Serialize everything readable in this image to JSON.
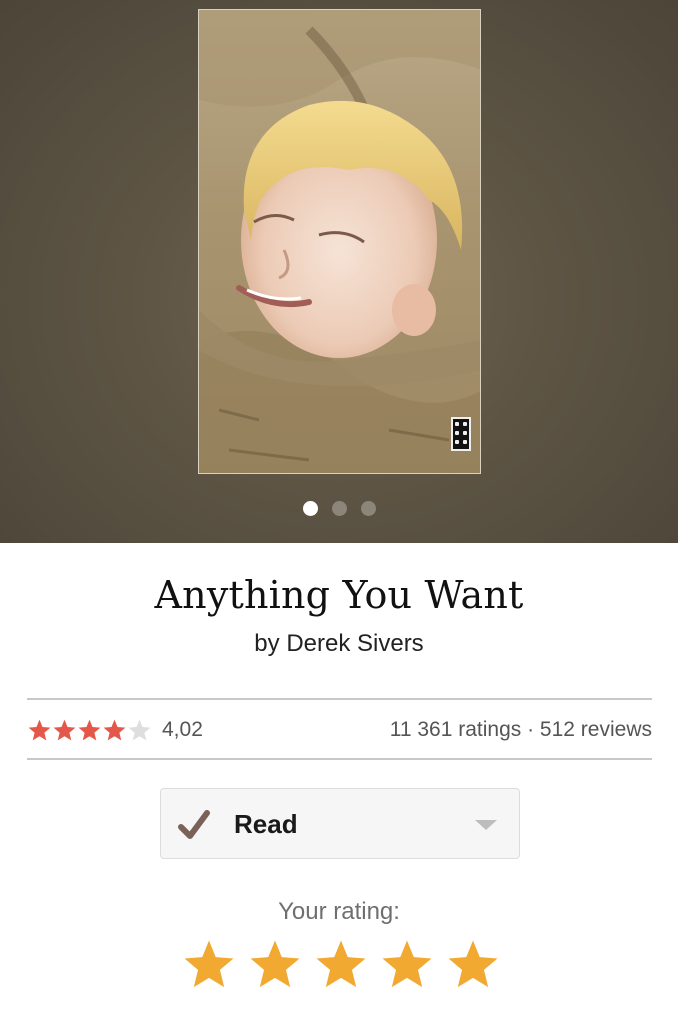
{
  "book": {
    "title": "Anything You Want",
    "author_line": "by Derek Sivers"
  },
  "carousel": {
    "page_count": 3,
    "active_index": 0
  },
  "ratings": {
    "average_stars": 4,
    "average_text": "4,02",
    "counts_text": "11 361 ratings · 512 reviews",
    "star_color": "#e4584a",
    "empty_star_color": "#dedede"
  },
  "shelf": {
    "status_label": "Read",
    "check_icon": "checkmark-icon",
    "check_color": "#7b6258"
  },
  "your_rating": {
    "label": "Your rating:",
    "value": 5,
    "max": 5,
    "star_color": "#f1a931"
  }
}
